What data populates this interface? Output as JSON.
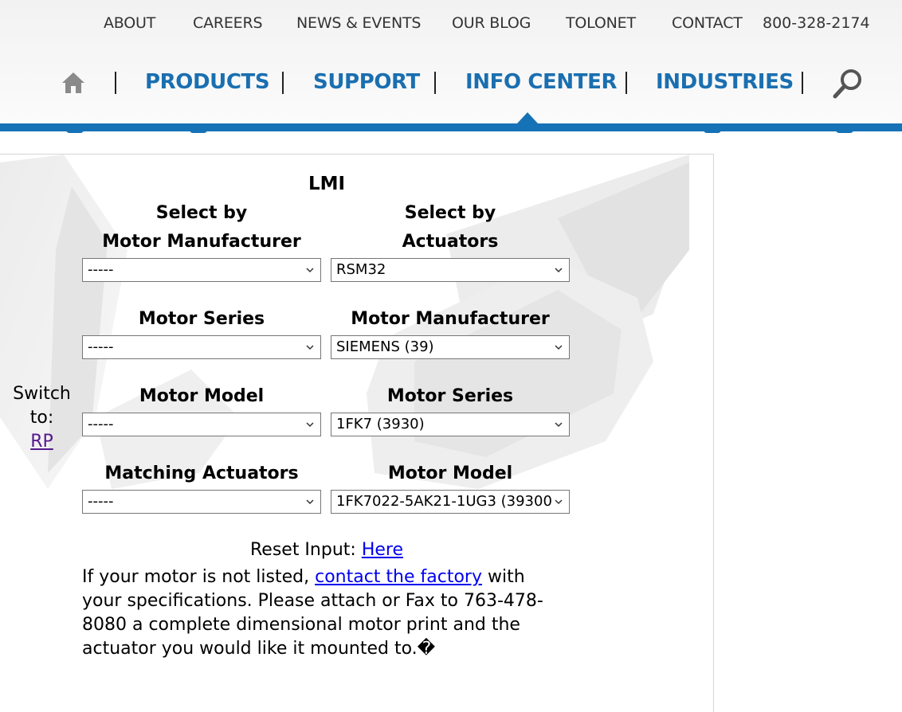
{
  "header": {
    "top_links": [
      "ABOUT",
      "CAREERS",
      "NEWS & EVENTS",
      "OUR BLOG",
      "TOLONET",
      "CONTACT"
    ],
    "phone": "800-328-2174",
    "main_nav": [
      "PRODUCTS",
      "SUPPORT",
      "INFO CENTER",
      "INDUSTRIES"
    ],
    "active_item": "INFO CENTER",
    "brand_color": "#1672b6",
    "home_icon": "home-icon",
    "search_icon": "search-icon"
  },
  "form": {
    "title": "LMI",
    "left": {
      "heading_line1": "Select by",
      "heading_line2": "Motor Manufacturer",
      "fields": [
        {
          "label": "Motor Series",
          "value": "-----"
        },
        {
          "label": "Motor Model",
          "value": "-----"
        },
        {
          "label": "Matching Actuators",
          "value": "-----"
        }
      ],
      "manufacturer_value": "-----"
    },
    "right": {
      "heading_line1": "Select by",
      "heading_line2": "Actuators",
      "actuator_value": "RSM32",
      "fields": [
        {
          "label": "Motor Manufacturer",
          "value": "SIEMENS (39)"
        },
        {
          "label": "Motor Series",
          "value": "1FK7 (3930)"
        },
        {
          "label": "Motor Model",
          "value": "1FK7022-5AK21-1UG3 (39300"
        }
      ]
    },
    "switch": {
      "line1": "Switch",
      "line2": "to:",
      "link": "RP"
    },
    "reset": {
      "label": "Reset Input:",
      "link": "Here"
    },
    "note": {
      "before": "If your motor is not listed,",
      "link": "contact the factory",
      "after": "with your specifications. Please attach or Fax to 763-478-8080 a complete dimensional motor print and the actuator you would like it mounted to.�"
    }
  }
}
